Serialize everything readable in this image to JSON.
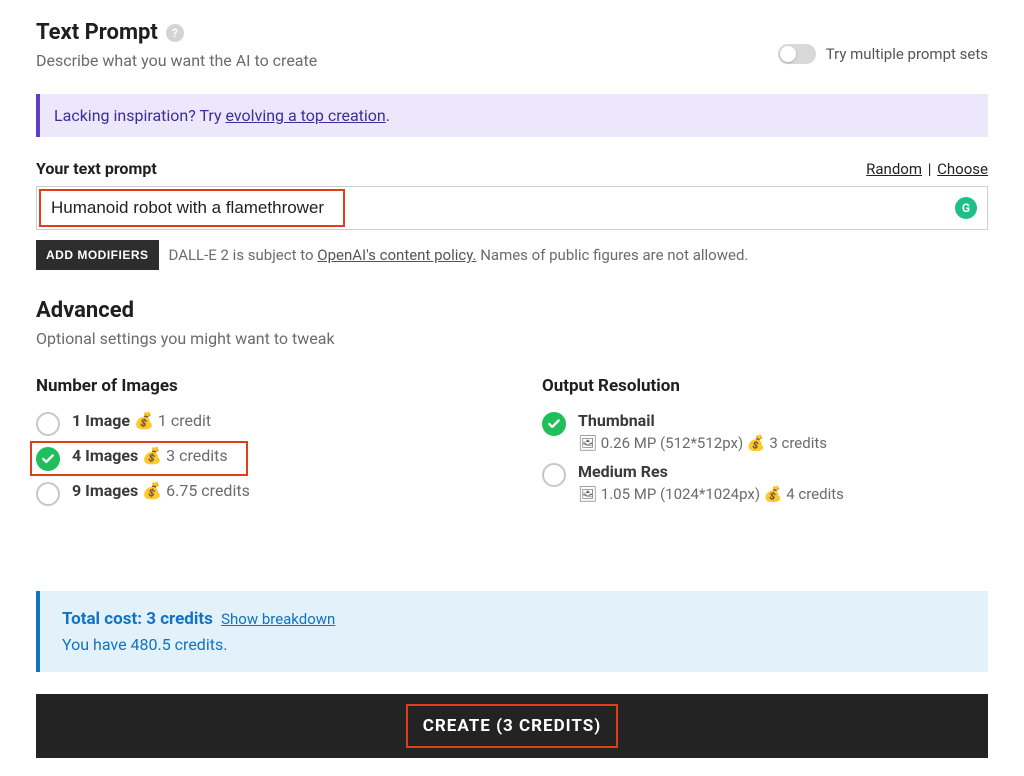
{
  "header": {
    "title": "Text Prompt",
    "subtitle": "Describe what you want the AI to create",
    "toggle_label": "Try multiple prompt sets"
  },
  "banner": {
    "prefix": "Lacking inspiration? Try ",
    "link": "evolving a top creation",
    "suffix": "."
  },
  "prompt": {
    "label": "Your text prompt",
    "random": "Random",
    "choose": "Choose",
    "value": "Humanoid robot with a flamethrower"
  },
  "modifiers": {
    "button": "ADD MODIFIERS",
    "text_prefix": "DALL-E 2 is subject to ",
    "policy_link": "OpenAI's content policy.",
    "text_suffix": " Names of public figures are not allowed."
  },
  "advanced": {
    "title": "Advanced",
    "subtitle": "Optional settings you might want to tweak"
  },
  "numImages": {
    "title": "Number of Images",
    "opts": [
      {
        "label": "1 Image",
        "credit": "1 credit"
      },
      {
        "label": "4 Images",
        "credit": "3 credits"
      },
      {
        "label": "9 Images",
        "credit": "6.75 credits"
      }
    ]
  },
  "resolution": {
    "title": "Output Resolution",
    "opts": [
      {
        "label": "Thumbnail",
        "detail": "0.26 MP (512*512px)",
        "credit": "3 credits"
      },
      {
        "label": "Medium Res",
        "detail": "1.05 MP (1024*1024px)",
        "credit": "4 credits"
      }
    ]
  },
  "cost": {
    "total": "Total cost: 3 credits",
    "breakdown": "Show breakdown",
    "balance": "You have 480.5 credits."
  },
  "create": {
    "label": "CREATE (3 CREDITS)"
  },
  "icons": {
    "moneybag": "💰",
    "picture": "🖼"
  }
}
